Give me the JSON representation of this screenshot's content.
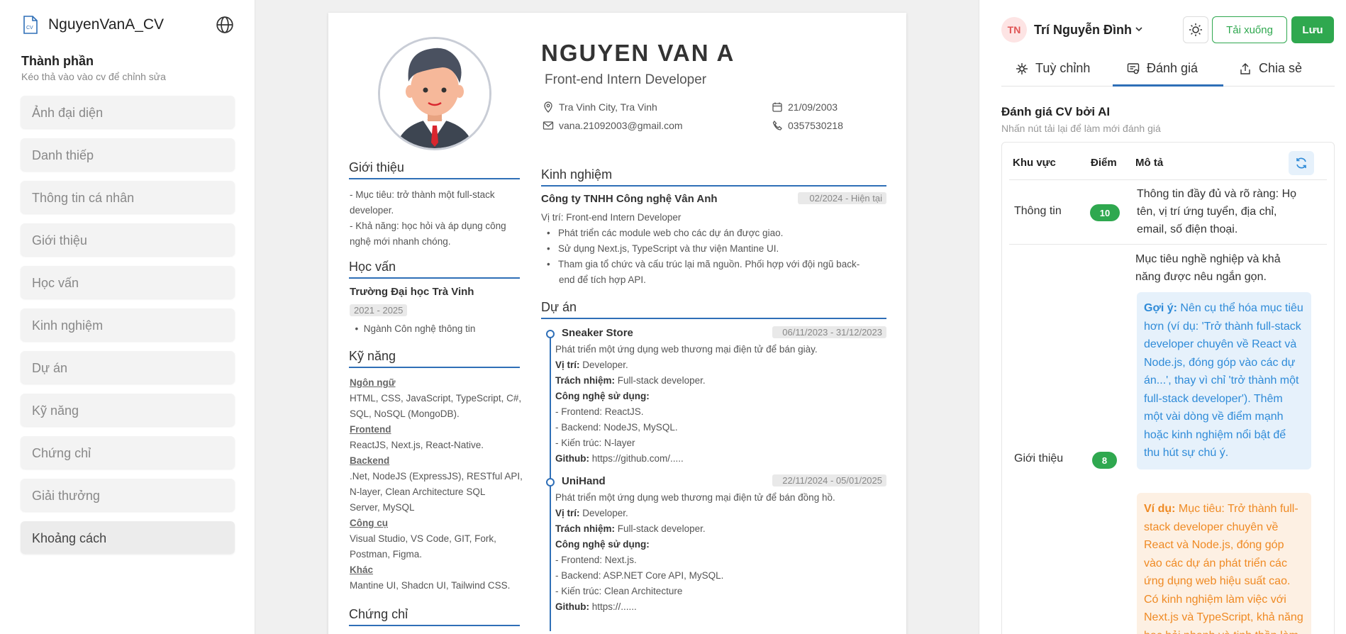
{
  "left": {
    "file_name": "NguyenVanA_CV",
    "section_title": "Thành phần",
    "section_subtitle": "Kéo thả vào vào cv để chỉnh sửa",
    "components": [
      "Ảnh đại diện",
      "Danh thiếp",
      "Thông tin cá nhân",
      "Giới thiệu",
      "Học vấn",
      "Kinh nghiệm",
      "Dự án",
      "Kỹ năng",
      "Chứng chỉ",
      "Giải thưởng",
      "Khoảng cách"
    ]
  },
  "cv": {
    "name": "NGUYEN VAN A",
    "title": "Front-end Intern Developer",
    "location": "Tra Vinh City, Tra Vinh",
    "birthday": "21/09/2003",
    "email": "vana.21092003@gmail.com",
    "phone": "0357530218",
    "intro": {
      "heading": "Giới thiệu",
      "lines": [
        "- Mục tiêu: trở thành một full-stack",
        "developer.",
        "- Khả năng: học hỏi và áp dụng công",
        "nghệ mới nhanh chóng."
      ]
    },
    "education": {
      "heading": "Học vấn",
      "school": "Trường Đại học Trà Vinh",
      "years": "2021 - 2025",
      "major": "Ngành Côn nghệ thông tin"
    },
    "skills": {
      "heading": "Kỹ năng",
      "groups": [
        {
          "label": "Ngôn ngữ",
          "lines": [
            "HTML, CSS, JavaScript, TypeScript, C#,",
            "SQL, NoSQL (MongoDB)."
          ]
        },
        {
          "label": "Frontend",
          "lines": [
            "ReactJS, Next.js, React-Native."
          ]
        },
        {
          "label": "Backend",
          "lines": [
            ".Net, NodeJS (ExpressJS), RESTful API,",
            "N-layer, Clean Architecture SQL",
            "Server, MySQL"
          ]
        },
        {
          "label": "Công cụ",
          "lines": [
            "Visual Studio, VS Code, GIT, Fork,",
            "Postman, Figma."
          ]
        },
        {
          "label": "Khác",
          "lines": [
            "Mantine UI, Shadcn UI, Tailwind CSS."
          ]
        }
      ]
    },
    "cert_heading": "Chứng chỉ",
    "experience": {
      "heading": "Kinh nghiệm",
      "company": "Công ty TNHH Công nghệ Vân Anh",
      "period": "02/2024 - Hiện tại",
      "position": "Vị trí: Front-end Intern Developer",
      "bullets": [
        "Phát triển các module web cho các dự án được giao.",
        "Sử dụng Next.js, TypeScript và thư viện Mantine UI.",
        "Tham gia tổ chức và cấu trúc lại mã nguồn. Phối hợp với đội ngũ back-",
        "end để tích hợp API."
      ]
    },
    "projects": {
      "heading": "Dự án",
      "items": [
        {
          "name": "Sneaker Store",
          "period": "06/11/2023 - 31/12/2023",
          "summary": "Phát triển một ứng dụng web thương mại điện tử để bán giày.",
          "role_label": "Vị trí:",
          "role": " Developer.",
          "duty_label": "Trách nhiệm:",
          "duty": " Full-stack developer.",
          "tech_label": "Công nghệ sử dụng:",
          "fe": "- Frontend: ReactJS.",
          "be": "- Backend: NodeJS, MySQL.",
          "arch": "- Kiến trúc: N-layer",
          "gh_label": "Github:",
          "gh": " https://github.com/....."
        },
        {
          "name": "UniHand",
          "period": "22/11/2024 - 05/01/2025",
          "summary": "Phát triển một ứng dụng web thương mại điện tử để bán đồng hồ.",
          "role_label": "Vị trí:",
          "role": " Developer.",
          "duty_label": "Trách nhiệm:",
          "duty": " Full-stack developer.",
          "tech_label": "Công nghệ sử dụng:",
          "fe": "- Frontend: Next.js.",
          "be": "- Backend: ASP.NET Core API, MySQL.",
          "arch": "- Kiến trúc: Clean Architecture",
          "gh_label": "Github:",
          "gh": " https://......"
        }
      ]
    }
  },
  "right": {
    "user_initials": "TN",
    "user_name": "Trí Nguyễn Đình",
    "download_label": "Tải xuống",
    "save_label": "Lưu",
    "tabs": [
      "Tuỳ chỉnh",
      "Đánh giá",
      "Chia sẻ"
    ],
    "rating_title": "Đánh giá CV bởi AI",
    "rating_subtitle": "Nhấn nút tải lại để làm mới đánh giá",
    "table_headers": [
      "Khu vực",
      "Điểm",
      "Mô tả"
    ],
    "rows": [
      {
        "area": "Thông tin",
        "score": "10",
        "desc_lines": [
          "Thông tin đầy đủ và rõ ràng: Họ",
          "tên, vị trí ứng tuyển, địa chỉ,",
          "email, số điện thoại."
        ]
      },
      {
        "area": "Giới thiệu",
        "score": "8",
        "desc_lines": [
          "Mục tiêu nghề nghiệp và khả",
          "năng được nêu ngắn gọn."
        ],
        "suggest_label": "Gợi ý:",
        "suggest_text": " Nên cụ thể hóa mục tiêu hơn (ví dụ: 'Trở thành full-stack developer chuyên về React và Node.js, đóng góp vào các dự án...', thay vì chỉ 'trở thành một full-stack developer'). Thêm một vài dòng về điểm mạnh hoặc kinh nghiệm nổi bật để thu hút sự chú ý.",
        "example_label": "Ví dụ:",
        "example_text": " Mục tiêu: Trở thành full-stack developer chuyên về React và Node.js, đóng góp vào các dự án phát triển các ứng dụng web hiệu suất cao. Có kinh nghiệm làm việc với Next.js và TypeScript, khả năng học hỏi nhanh và tinh thần làm"
      }
    ]
  },
  "colors": {
    "accent": "#2f6fb7",
    "green": "#2fa84f",
    "suggest": "#2f8bd8",
    "example": "#ef8a24"
  }
}
